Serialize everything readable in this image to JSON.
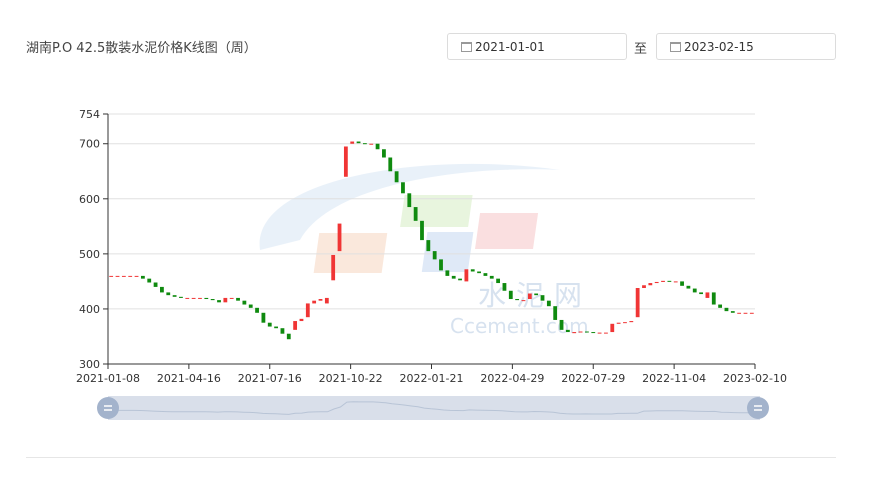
{
  "header": {
    "title": "湖南P.O 42.5散装水泥价格K线图（周）",
    "start_date": "2021-01-01",
    "to_label": "至",
    "end_date": "2023-02-15"
  },
  "colors": {
    "up": "#f03535",
    "down": "#0f8a0f",
    "grid": "#e0e0e0",
    "slider": "#d5dce8",
    "handle": "#a3b3cc"
  },
  "chart_data": {
    "type": "candlestick",
    "title": "湖南P.O 42.5散装水泥价格K线图（周）",
    "ylim": [
      300,
      754
    ],
    "y_ticks": [
      300,
      400,
      500,
      600,
      700,
      754
    ],
    "x_tick_labels": [
      "2021-01-08",
      "2021-04-16",
      "2021-07-16",
      "2021-10-22",
      "2022-01-21",
      "2022-04-29",
      "2022-07-29",
      "2022-11-04",
      "2023-02-10"
    ],
    "watermark": "Ccement.com",
    "watermark_cn": "水泥网",
    "series": [
      {
        "candles": [
          [
            460,
            460
          ],
          [
            460,
            460
          ],
          [
            460,
            460
          ],
          [
            460,
            460
          ],
          [
            460,
            460
          ],
          [
            460,
            455
          ],
          [
            455,
            448
          ],
          [
            448,
            440
          ],
          [
            440,
            430
          ],
          [
            430,
            425
          ],
          [
            425,
            422
          ],
          [
            422,
            420
          ],
          [
            420,
            420
          ],
          [
            420,
            420
          ],
          [
            420,
            420
          ],
          [
            420,
            418
          ],
          [
            418,
            416
          ],
          [
            416,
            412
          ],
          [
            412,
            420
          ],
          [
            420,
            420
          ],
          [
            420,
            415
          ],
          [
            415,
            408
          ],
          [
            408,
            402
          ],
          [
            402,
            393
          ],
          [
            393,
            375
          ],
          [
            375,
            368
          ],
          [
            368,
            365
          ],
          [
            365,
            355
          ],
          [
            355,
            345
          ],
          [
            362,
            378
          ],
          [
            378,
            382
          ],
          [
            385,
            410
          ],
          [
            410,
            415
          ],
          [
            415,
            418
          ],
          [
            410,
            420
          ],
          [
            452,
            498
          ],
          [
            505,
            555
          ],
          [
            640,
            695
          ],
          [
            700,
            704
          ],
          [
            704,
            701
          ],
          [
            701,
            700
          ],
          [
            700,
            700
          ],
          [
            700,
            690
          ],
          [
            690,
            675
          ],
          [
            675,
            650
          ],
          [
            650,
            630
          ],
          [
            630,
            610
          ],
          [
            610,
            585
          ],
          [
            585,
            560
          ],
          [
            560,
            525
          ],
          [
            525,
            505
          ],
          [
            505,
            490
          ],
          [
            490,
            470
          ],
          [
            470,
            460
          ],
          [
            460,
            455
          ],
          [
            455,
            452
          ],
          [
            450,
            472
          ],
          [
            472,
            468
          ],
          [
            468,
            465
          ],
          [
            465,
            460
          ],
          [
            460,
            455
          ],
          [
            455,
            447
          ],
          [
            447,
            433
          ],
          [
            433,
            418
          ],
          [
            418,
            416
          ],
          [
            416,
            416
          ],
          [
            418,
            428
          ],
          [
            428,
            425
          ],
          [
            425,
            415
          ],
          [
            415,
            405
          ],
          [
            405,
            380
          ],
          [
            380,
            362
          ],
          [
            362,
            358
          ],
          [
            356,
            358
          ],
          [
            358,
            359
          ],
          [
            359,
            358
          ],
          [
            358,
            357
          ],
          [
            357,
            357
          ],
          [
            357,
            357
          ],
          [
            358,
            373
          ],
          [
            373,
            375
          ],
          [
            375,
            376
          ],
          [
            376,
            378
          ],
          [
            385,
            438
          ],
          [
            438,
            443
          ],
          [
            443,
            447
          ],
          [
            447,
            449
          ],
          [
            449,
            451
          ],
          [
            451,
            450
          ],
          [
            450,
            450
          ],
          [
            450,
            442
          ],
          [
            442,
            437
          ],
          [
            437,
            430
          ],
          [
            430,
            427
          ],
          [
            420,
            430
          ],
          [
            430,
            408
          ],
          [
            408,
            402
          ],
          [
            402,
            396
          ],
          [
            396,
            393
          ],
          [
            393,
            393
          ],
          [
            393,
            393
          ],
          [
            393,
            393
          ]
        ]
      }
    ]
  }
}
